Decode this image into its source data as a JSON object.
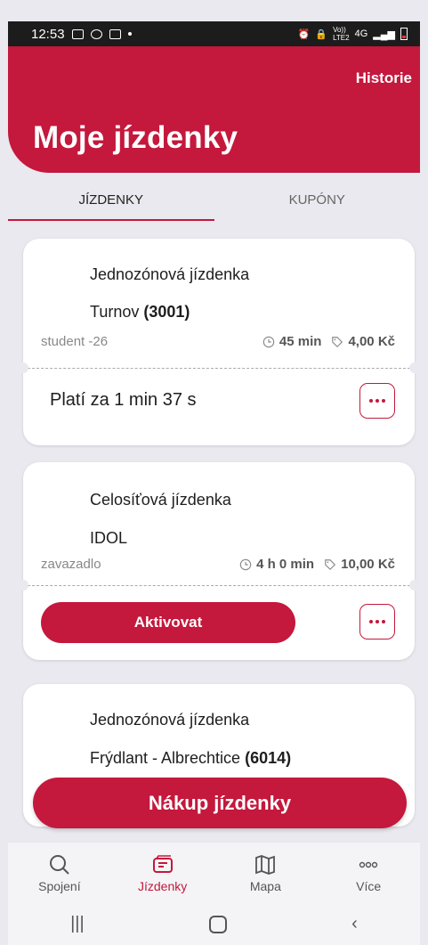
{
  "status_bar": {
    "time": "12:53",
    "net_top": "Vo))",
    "net_bottom": "LTE2",
    "gen": "4G"
  },
  "header": {
    "history_label": "Historie",
    "title": "Moje jízdenky"
  },
  "tabs": [
    {
      "label": "JÍZDENKY"
    },
    {
      "label": "KUPÓNY"
    }
  ],
  "tickets": [
    {
      "name": "Jednozónová jízdenka",
      "zone": "Turnov",
      "zone_code": "(3001)",
      "type": "student -26",
      "duration": "45 min",
      "price": "4,00 Kč",
      "validity": "Platí za 1 min 37 s"
    },
    {
      "name": "Celosíťová jízdenka",
      "zone": "IDOL",
      "zone_code": "",
      "type": "zavazadlo",
      "duration": "4 h 0 min",
      "price": "10,00 Kč",
      "action_label": "Aktivovat"
    },
    {
      "name": "Jednozónová jízdenka",
      "zone": "Frýdlant - Albrechtice",
      "zone_code": "(6014)"
    }
  ],
  "buy_button": {
    "label": "Nákup jízdenky"
  },
  "bottom_nav": [
    {
      "label": "Spojení",
      "icon": "search-icon"
    },
    {
      "label": "Jízdenky",
      "icon": "ticket-icon"
    },
    {
      "label": "Mapa",
      "icon": "map-icon"
    },
    {
      "label": "Více",
      "icon": "more-icon"
    }
  ],
  "colors": {
    "accent": "#c4183c",
    "background": "#e9e9ef"
  }
}
